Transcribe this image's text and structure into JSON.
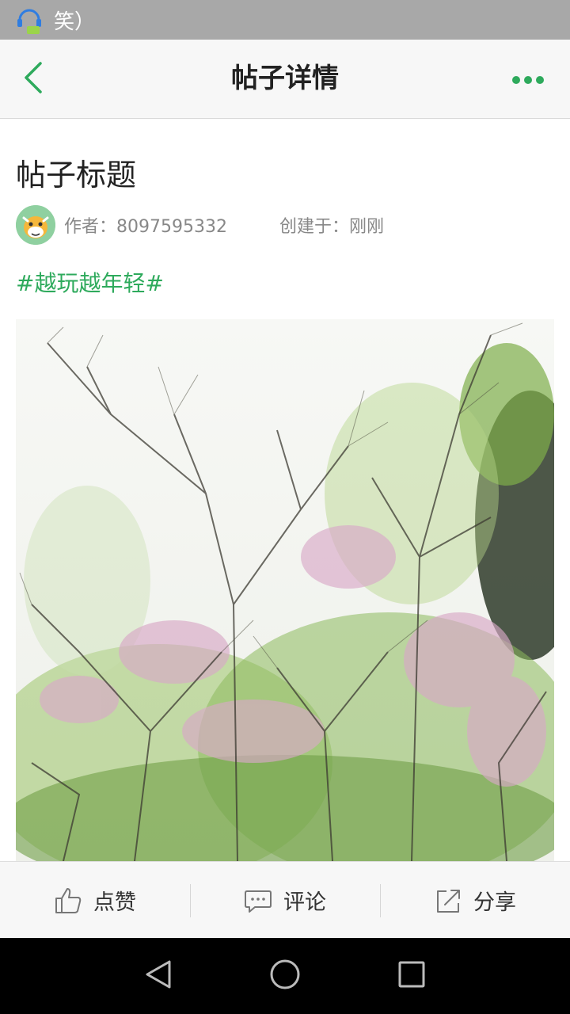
{
  "status_bar": {
    "text": "笑）",
    "app_icon": "headset-icon"
  },
  "header": {
    "title": "帖子详情",
    "back_icon": "chevron-left-icon",
    "more_icon": "more-dots-icon",
    "accent": "#2eaa5c"
  },
  "post": {
    "title": "帖子标题",
    "author": "作者：8097595332",
    "created": "创建于：刚刚",
    "tag": "#越玩越年轻#",
    "image_alt": "flowering-tree-photo"
  },
  "actions": [
    {
      "label": "点赞",
      "icon": "thumbs-up-icon"
    },
    {
      "label": "评论",
      "icon": "chat-bubble-icon"
    },
    {
      "label": "分享",
      "icon": "share-icon"
    }
  ],
  "nav": {
    "back": "nav-back-icon",
    "home": "nav-home-icon",
    "recents": "nav-recents-icon"
  }
}
